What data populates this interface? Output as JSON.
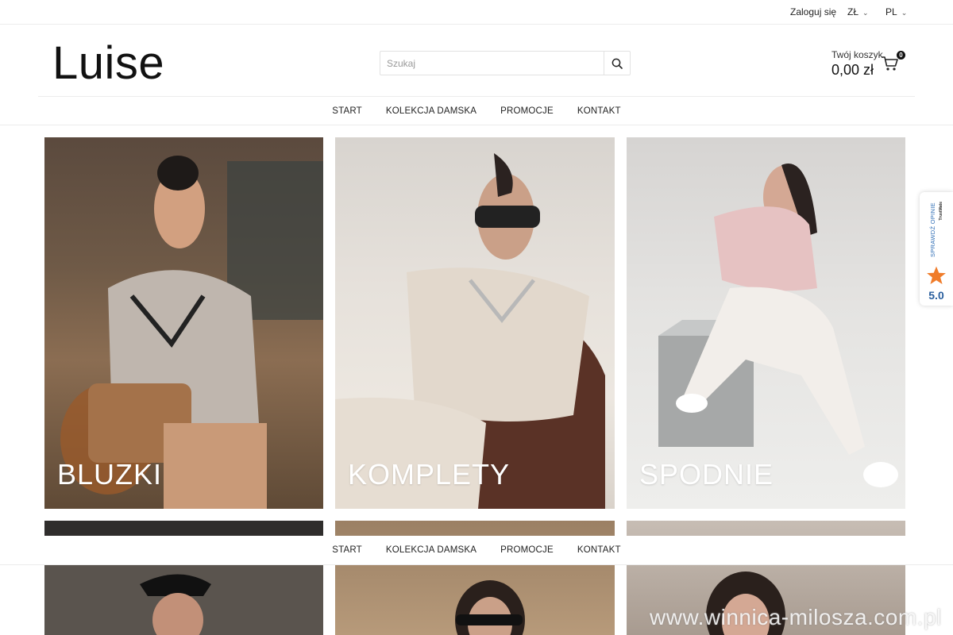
{
  "topbar": {
    "login_label": "Zaloguj się",
    "currency": "ZŁ",
    "language": "PL"
  },
  "header": {
    "logo_text": "Luise",
    "search_placeholder": "Szukaj",
    "cart_label": "Twój koszyk",
    "cart_amount": "0,00 zł",
    "cart_count": "0"
  },
  "nav": {
    "items": [
      {
        "label": "START"
      },
      {
        "label": "KOLEKCJA DAMSKA"
      },
      {
        "label": "PROMOCJE"
      },
      {
        "label": "KONTAKT"
      }
    ]
  },
  "tiles": [
    {
      "label": "BLUZKI"
    },
    {
      "label": "KOMPLETY"
    },
    {
      "label": "SPODNIE"
    },
    {
      "label": ""
    },
    {
      "label": ""
    },
    {
      "label": ""
    }
  ],
  "trust_widget": {
    "text": "SPRAWDŹ OPINIE",
    "brand": "TrustMate",
    "rating": "5.0",
    "star_color": "#f07c2a"
  },
  "watermark": "www.winnica-milosza.com.pl"
}
